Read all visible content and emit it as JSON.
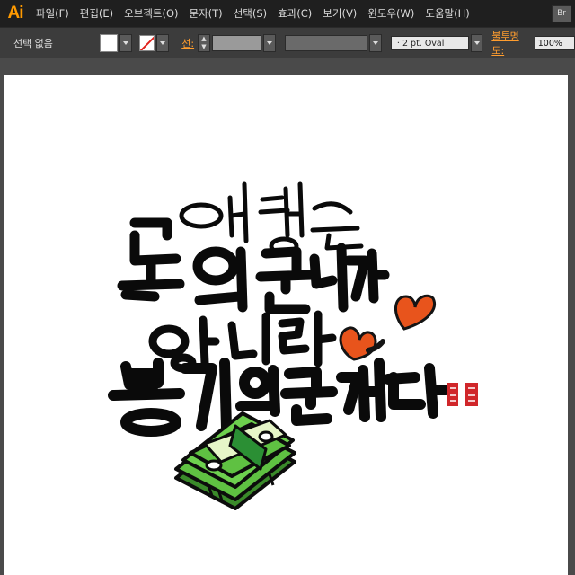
{
  "app": {
    "logo": "Ai"
  },
  "menubar": {
    "items": [
      "파일(F)",
      "편집(E)",
      "오브젝트(O)",
      "문자(T)",
      "선택(S)",
      "효과(C)",
      "보기(V)",
      "윈도우(W)",
      "도움말(H)"
    ],
    "bridge_button": "Br"
  },
  "control_bar": {
    "selection_status": "선택 없음",
    "fill_color": "#ffffff",
    "stroke_label": "선:",
    "brush_name": "2 pt. Oval",
    "opacity_label": "불투명도:",
    "opacity_value": "100%"
  },
  "artwork": {
    "ink_color": "#0a0a0a",
    "heart_color": "#e8541c",
    "money_color": "#5fc142",
    "seal_color": "#d0262a"
  }
}
